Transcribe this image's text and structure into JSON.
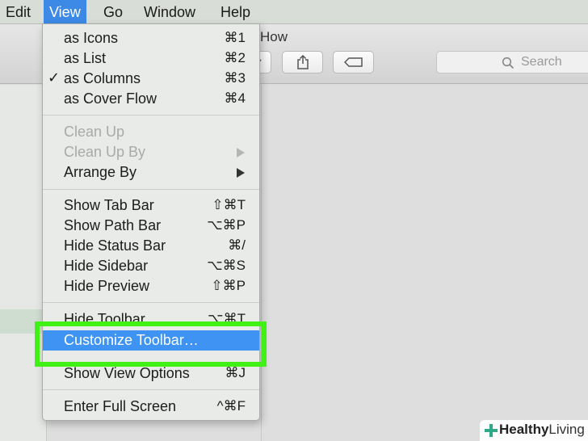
{
  "menubar": {
    "items": [
      {
        "label": "Edit"
      },
      {
        "label": "View"
      },
      {
        "label": "Go"
      },
      {
        "label": "Window"
      },
      {
        "label": "Help"
      }
    ],
    "active_index": 1
  },
  "window": {
    "title": "How",
    "toolbar": {
      "share_icon": "share-icon",
      "tag_icon": "tag-icon",
      "view_dropdown_icon": "chevron-down-icon"
    },
    "search": {
      "placeholder": "Search",
      "icon": "search-icon"
    }
  },
  "view_menu": {
    "items": [
      {
        "label": "as Icons",
        "shortcut": "⌘1"
      },
      {
        "label": "as List",
        "shortcut": "⌘2"
      },
      {
        "label": "as Columns",
        "shortcut": "⌘3",
        "checked": true,
        "check_mark": "✓"
      },
      {
        "label": "as Cover Flow",
        "shortcut": "⌘4"
      },
      {
        "label": "Clean Up",
        "disabled": true
      },
      {
        "label": "Clean Up By",
        "disabled": true,
        "submenu": true
      },
      {
        "label": "Arrange By",
        "submenu": true
      },
      {
        "label": "Show Tab Bar",
        "shortcut": "⇧⌘T"
      },
      {
        "label": "Show Path Bar",
        "shortcut": "⌥⌘P"
      },
      {
        "label": "Hide Status Bar",
        "shortcut": "⌘/"
      },
      {
        "label": "Hide Sidebar",
        "shortcut": "⌥⌘S"
      },
      {
        "label": "Hide Preview",
        "shortcut": "⇧⌘P"
      },
      {
        "label": "Hide Toolbar",
        "shortcut": "⌥⌘T"
      },
      {
        "label": "Customize Toolbar…",
        "highlighted": true
      },
      {
        "label": "Show View Options",
        "shortcut": "⌘J"
      },
      {
        "label": "Enter Full Screen",
        "shortcut": "^⌘F"
      }
    ]
  },
  "annotation": {
    "highlight_color": "#41f014"
  },
  "watermark": {
    "brand_bold": "Healthy",
    "brand_regular": "Living",
    "icon": "plus-leaf-icon"
  }
}
